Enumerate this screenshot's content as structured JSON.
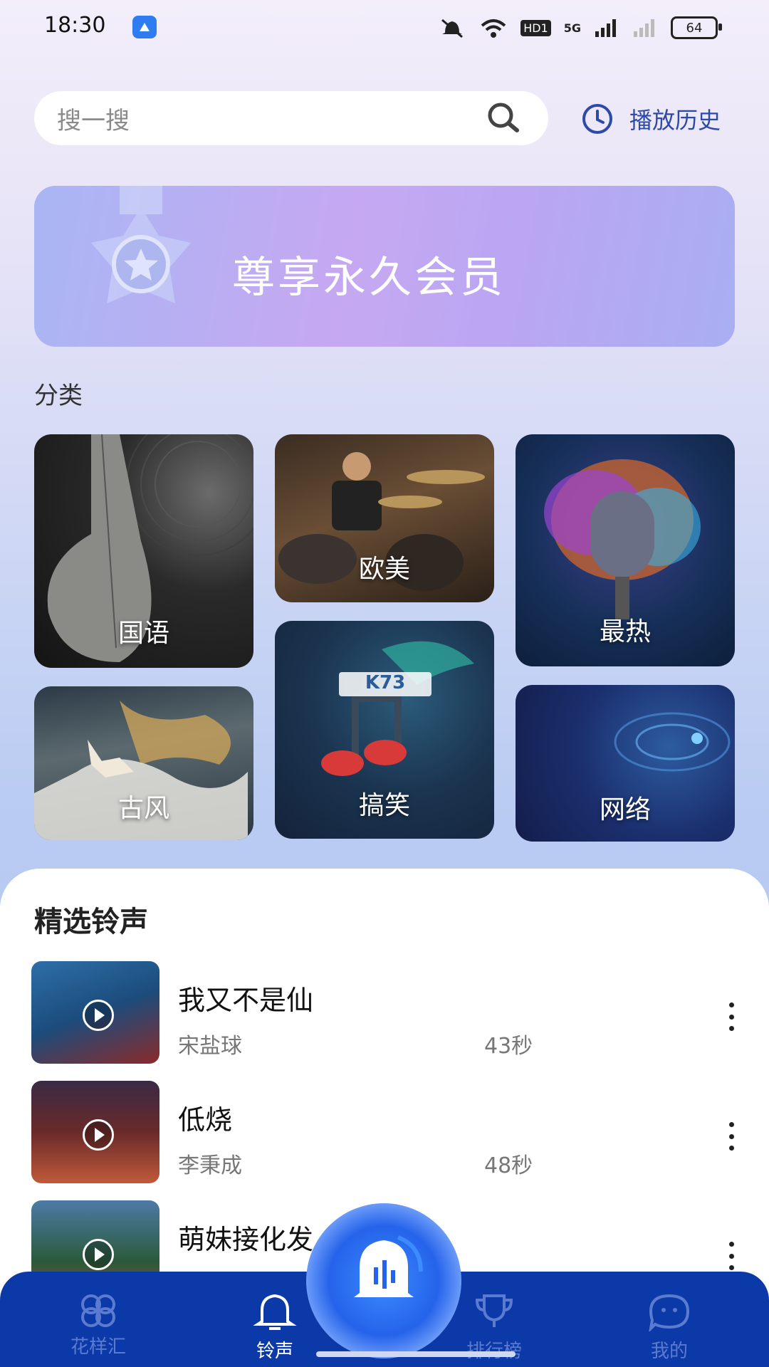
{
  "status_bar": {
    "time": "18:30",
    "battery": "64",
    "network": "5G",
    "hd": "HD1"
  },
  "search": {
    "placeholder": "搜一搜"
  },
  "history": {
    "label": "播放历史"
  },
  "banner": {
    "text": "尊享永久会员"
  },
  "categories": {
    "title": "分类",
    "items": [
      {
        "label": "国语"
      },
      {
        "label": "欧美"
      },
      {
        "label": "最热"
      },
      {
        "label": "古风"
      },
      {
        "label": "搞笑"
      },
      {
        "label": "网络"
      }
    ]
  },
  "watermark": {
    "text": "K73"
  },
  "featured": {
    "title": "精选铃声",
    "songs": [
      {
        "title": "我又不是仙",
        "artist": "宋盐球",
        "duration": "43秒"
      },
      {
        "title": "低烧",
        "artist": "李秉成",
        "duration": "48秒"
      },
      {
        "title": "萌妹接化发",
        "artist": "",
        "duration": ""
      }
    ]
  },
  "nav": {
    "items": [
      {
        "label": "花样汇",
        "icon": "clover-icon"
      },
      {
        "label": "铃声",
        "icon": "bell-icon",
        "active": true
      },
      {
        "label": "排行榜",
        "icon": "trophy-icon"
      },
      {
        "label": "我的",
        "icon": "chat-face-icon"
      }
    ]
  },
  "colors": {
    "nav_bg": "#0b3aa8",
    "accent": "#2d4aa6",
    "active_nav": "#ffffff"
  }
}
